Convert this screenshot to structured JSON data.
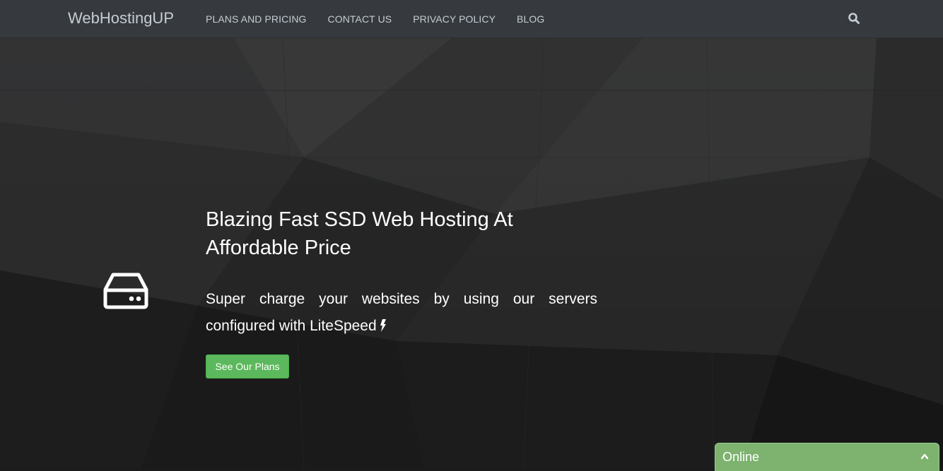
{
  "navbar": {
    "brand": "WebHostingUP",
    "links": [
      {
        "label": "PLANS AND PRICING"
      },
      {
        "label": "CONTACT US"
      },
      {
        "label": "PRIVACY POLICY"
      },
      {
        "label": "BLOG"
      }
    ],
    "search_icon": "search-icon"
  },
  "hero": {
    "icon": "server-hdd-icon",
    "headline": "Blazing Fast SSD Web Hosting At Affordable Price",
    "subtext": "Super charge your websites by using our servers configured with LiteSpeed",
    "subtext_icon": "bolt-icon",
    "cta_label": "See Our Plans"
  },
  "chat_widget": {
    "status": "Online",
    "toggle_icon": "chevron-up-icon"
  },
  "colors": {
    "navbar_bg": "#363a3e",
    "nav_text": "#c5ccd4",
    "cta_green": "#5cb85c",
    "chat_green": "#7db26f"
  }
}
